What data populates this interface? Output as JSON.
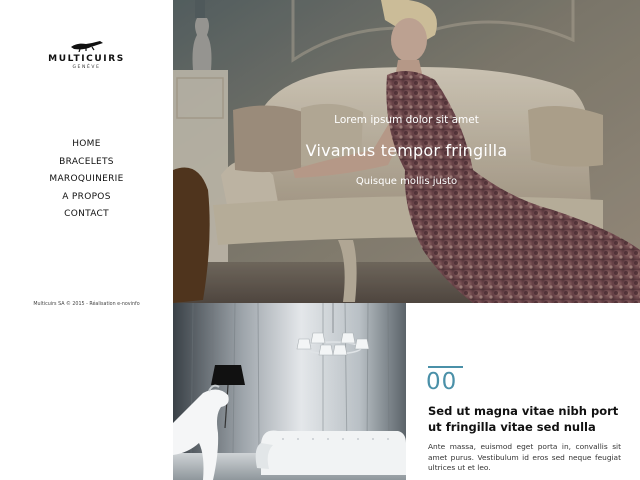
{
  "brand": {
    "name": "MULTICUIRS",
    "subtitle": "GENÈVE",
    "mark_icon": "crocodile-logo-icon"
  },
  "nav": {
    "items": [
      {
        "label": "HOME"
      },
      {
        "label": "BRACELETS"
      },
      {
        "label": "MAROQUINERIE"
      },
      {
        "label": "A PROPOS"
      },
      {
        "label": "CONTACT"
      }
    ]
  },
  "footer": {
    "credit": "Multicuirs SA © 2015 - Réalisation e-novinfo"
  },
  "hero": {
    "kicker": "Lorem ipsum dolor sit amet",
    "title": "Vivamus tempor fringilla",
    "subtitle": "Quisque mollis justo"
  },
  "article": {
    "number": "00",
    "title": "Sed ut magna vitae nibh port ut fringilla vitae sed nulla",
    "body": "Ante massa, euismod eget porta in, convallis sit amet purus. Vestibulum id eros sed neque feugiat ultrices ut et leo."
  },
  "colors": {
    "accent": "#4a90a8"
  }
}
